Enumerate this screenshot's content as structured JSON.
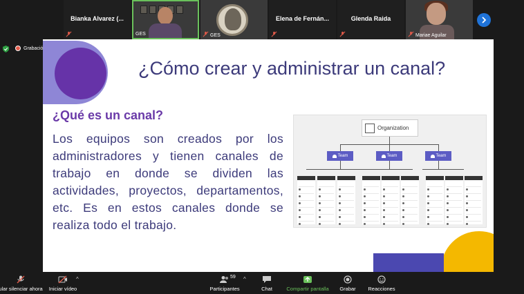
{
  "participants": [
    {
      "name": "Bianka Alvarez (...",
      "video": false,
      "muted": true,
      "tag": ""
    },
    {
      "name": "",
      "video": true,
      "muted": false,
      "tag": "GES",
      "active": true
    },
    {
      "name": "",
      "video": true,
      "muted": true,
      "tag": "GES"
    },
    {
      "name": "Elena de Fernán...",
      "video": false,
      "muted": true,
      "tag": ""
    },
    {
      "name": "Glenda Raida",
      "video": false,
      "muted": true,
      "tag": ""
    },
    {
      "name": "",
      "video": true,
      "muted": true,
      "tag": "Mariae Aguilar"
    }
  ],
  "recording_label": "Grabación",
  "slide": {
    "title": "¿Cómo crear y administrar un canal?",
    "subtitle": "¿Qué es un canal?",
    "body": "Los equipos son creados por los administradores y tienen canales de trabajo en donde se dividen las actividades, proyectos, departamentos, etc. Es en estos canales donde se realiza todo el trabajo.",
    "diagram": {
      "root": "Organization",
      "team_label": "Team",
      "channel_label": "Channel"
    }
  },
  "toolbar": {
    "mute_label": "ular silenciar ahora",
    "video_label": "Iniciar vídeo",
    "participants_label": "Participantes",
    "participants_count": "59",
    "chat_label": "Chat",
    "share_label": "Compartir pantalla",
    "record_label": "Grabar",
    "reactions_label": "Reacciones"
  },
  "colors": {
    "accent_green": "#6ac15b",
    "muted_red": "#e35b4a",
    "slide_title": "#3c3a7a",
    "slide_purple": "#6633a8",
    "slide_yellow": "#f4b800"
  }
}
